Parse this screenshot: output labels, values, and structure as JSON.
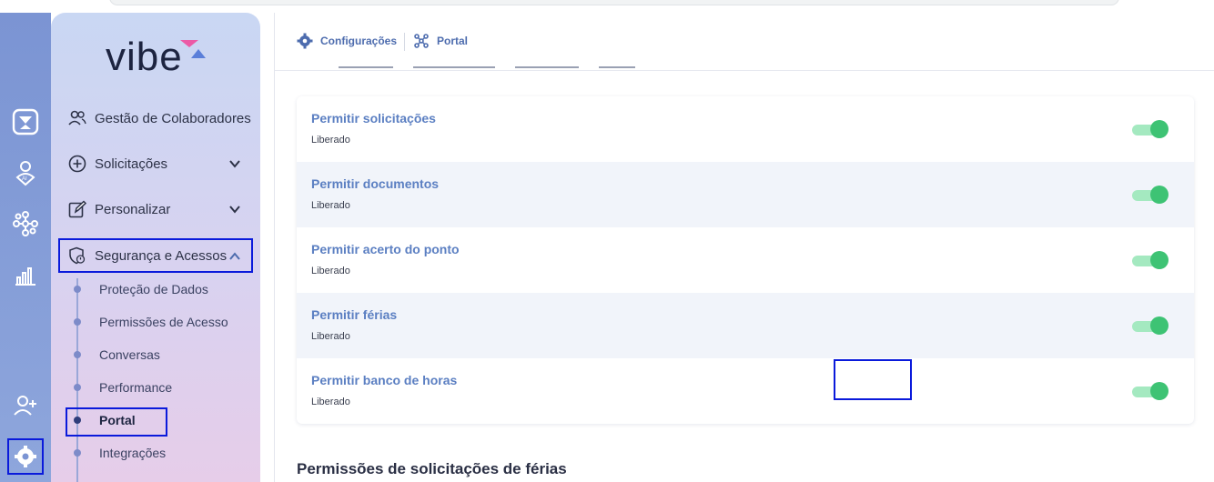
{
  "brand": {
    "logo_text": "vibe"
  },
  "rail": {
    "items": [
      "hourglass-app-icon",
      "ai-assistant-icon",
      "integrations-network-icon",
      "analytics-icon",
      "add-user-icon",
      "settings-icon"
    ]
  },
  "sidebar": {
    "items": [
      {
        "label": "Gestão de Colaboradores",
        "icon": "users-icon"
      },
      {
        "label": "Solicitações",
        "icon": "plus-circle-icon"
      },
      {
        "label": "Personalizar",
        "icon": "edit-icon"
      },
      {
        "label": "Segurança e Acessos",
        "icon": "shield-icon"
      }
    ],
    "subitems": [
      {
        "label": "Proteção de Dados"
      },
      {
        "label": "Permissões de Acesso"
      },
      {
        "label": "Conversas"
      },
      {
        "label": "Performance"
      },
      {
        "label": "Portal"
      },
      {
        "label": "Integrações"
      }
    ]
  },
  "breadcrumb": {
    "items": [
      {
        "label": "Configurações",
        "icon": "gear-icon"
      },
      {
        "label": "Portal",
        "icon": "portal-icon"
      }
    ]
  },
  "permissions": [
    {
      "title": "Permitir solicitações",
      "status": "Liberado",
      "enabled": true
    },
    {
      "title": "Permitir documentos",
      "status": "Liberado",
      "enabled": true
    },
    {
      "title": "Permitir acerto do ponto",
      "status": "Liberado",
      "enabled": true
    },
    {
      "title": "Permitir férias",
      "status": "Liberado",
      "enabled": true
    },
    {
      "title": "Permitir banco de horas",
      "status": "Liberado",
      "enabled": true
    }
  ],
  "section": {
    "title": "Permissões de solicitações de férias"
  },
  "colors": {
    "accent": "#4d6cae",
    "toggle_on": "#3ec374",
    "highlight_box": "#0a1adb"
  }
}
